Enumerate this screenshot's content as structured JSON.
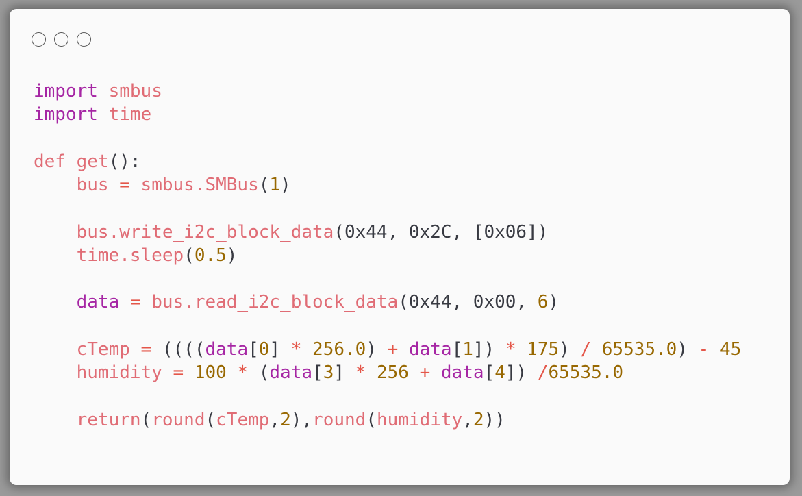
{
  "window": {
    "controls": [
      "window-dot-1",
      "window-dot-2",
      "window-dot-3"
    ]
  },
  "code_lines": [
    [
      {
        "t": "import",
        "c": "kw"
      },
      {
        "t": " ",
        "c": "pun"
      },
      {
        "t": "smbus",
        "c": "id"
      }
    ],
    [
      {
        "t": "import",
        "c": "kw"
      },
      {
        "t": " ",
        "c": "pun"
      },
      {
        "t": "time",
        "c": "id"
      }
    ],
    [],
    [
      {
        "t": "def",
        "c": "id"
      },
      {
        "t": " ",
        "c": "pun"
      },
      {
        "t": "get",
        "c": "fn"
      },
      {
        "t": "():",
        "c": "pun"
      }
    ],
    [
      {
        "t": "    bus",
        "c": "id"
      },
      {
        "t": " = ",
        "c": "op"
      },
      {
        "t": "smbus.SMBus",
        "c": "id"
      },
      {
        "t": "(",
        "c": "pun"
      },
      {
        "t": "1",
        "c": "num"
      },
      {
        "t": ")",
        "c": "pun"
      }
    ],
    [],
    [
      {
        "t": "    bus.write_i2c_block_data",
        "c": "id"
      },
      {
        "t": "(0x44, 0x2C, [0x06])",
        "c": "pun"
      }
    ],
    [
      {
        "t": "    time.sleep",
        "c": "id"
      },
      {
        "t": "(",
        "c": "pun"
      },
      {
        "t": "0.5",
        "c": "num"
      },
      {
        "t": ")",
        "c": "pun"
      }
    ],
    [],
    [
      {
        "t": "    data",
        "c": "var"
      },
      {
        "t": " = ",
        "c": "op"
      },
      {
        "t": "bus.read_i2c_block_data",
        "c": "id"
      },
      {
        "t": "(0x44, 0x00, ",
        "c": "pun"
      },
      {
        "t": "6",
        "c": "num"
      },
      {
        "t": ")",
        "c": "pun"
      }
    ],
    [],
    [
      {
        "t": "    cTemp",
        "c": "id"
      },
      {
        "t": " = ",
        "c": "op"
      },
      {
        "t": "((((",
        "c": "pun"
      },
      {
        "t": "data",
        "c": "var"
      },
      {
        "t": "[",
        "c": "pun"
      },
      {
        "t": "0",
        "c": "num"
      },
      {
        "t": "] ",
        "c": "pun"
      },
      {
        "t": "*",
        "c": "op"
      },
      {
        "t": " ",
        "c": "pun"
      },
      {
        "t": "256.0",
        "c": "num"
      },
      {
        "t": ") ",
        "c": "pun"
      },
      {
        "t": "+",
        "c": "op"
      },
      {
        "t": " ",
        "c": "pun"
      },
      {
        "t": "data",
        "c": "var"
      },
      {
        "t": "[",
        "c": "pun"
      },
      {
        "t": "1",
        "c": "num"
      },
      {
        "t": "]) ",
        "c": "pun"
      },
      {
        "t": "*",
        "c": "op"
      },
      {
        "t": " ",
        "c": "pun"
      },
      {
        "t": "175",
        "c": "num"
      },
      {
        "t": ") ",
        "c": "pun"
      },
      {
        "t": "/",
        "c": "op"
      },
      {
        "t": " ",
        "c": "pun"
      },
      {
        "t": "65535.0",
        "c": "num"
      },
      {
        "t": ") ",
        "c": "pun"
      },
      {
        "t": "-",
        "c": "op"
      },
      {
        "t": " ",
        "c": "pun"
      },
      {
        "t": "45",
        "c": "num"
      }
    ],
    [
      {
        "t": "    humidity",
        "c": "id"
      },
      {
        "t": " = ",
        "c": "op"
      },
      {
        "t": "100",
        "c": "num"
      },
      {
        "t": " ",
        "c": "pun"
      },
      {
        "t": "*",
        "c": "op"
      },
      {
        "t": " (",
        "c": "pun"
      },
      {
        "t": "data",
        "c": "var"
      },
      {
        "t": "[",
        "c": "pun"
      },
      {
        "t": "3",
        "c": "num"
      },
      {
        "t": "] ",
        "c": "pun"
      },
      {
        "t": "*",
        "c": "op"
      },
      {
        "t": " ",
        "c": "pun"
      },
      {
        "t": "256",
        "c": "num"
      },
      {
        "t": " ",
        "c": "pun"
      },
      {
        "t": "+",
        "c": "op"
      },
      {
        "t": " ",
        "c": "pun"
      },
      {
        "t": "data",
        "c": "var"
      },
      {
        "t": "[",
        "c": "pun"
      },
      {
        "t": "4",
        "c": "num"
      },
      {
        "t": "]) ",
        "c": "pun"
      },
      {
        "t": "/",
        "c": "op"
      },
      {
        "t": "65535.0",
        "c": "num"
      }
    ],
    [],
    [
      {
        "t": "    return",
        "c": "id"
      },
      {
        "t": "(",
        "c": "pun"
      },
      {
        "t": "round",
        "c": "fn"
      },
      {
        "t": "(",
        "c": "pun"
      },
      {
        "t": "cTemp",
        "c": "id"
      },
      {
        "t": ",",
        "c": "pun"
      },
      {
        "t": "2",
        "c": "num"
      },
      {
        "t": "),",
        "c": "pun"
      },
      {
        "t": "round",
        "c": "fn"
      },
      {
        "t": "(",
        "c": "pun"
      },
      {
        "t": "humidity",
        "c": "id"
      },
      {
        "t": ",",
        "c": "pun"
      },
      {
        "t": "2",
        "c": "num"
      },
      {
        "t": "))",
        "c": "pun"
      }
    ]
  ],
  "colors": {
    "keyword": "#a626a4",
    "identifier": "#e06c75",
    "number": "#986801",
    "operator": "#e45649",
    "punctuation": "#383a42",
    "background": "#fafafa"
  }
}
